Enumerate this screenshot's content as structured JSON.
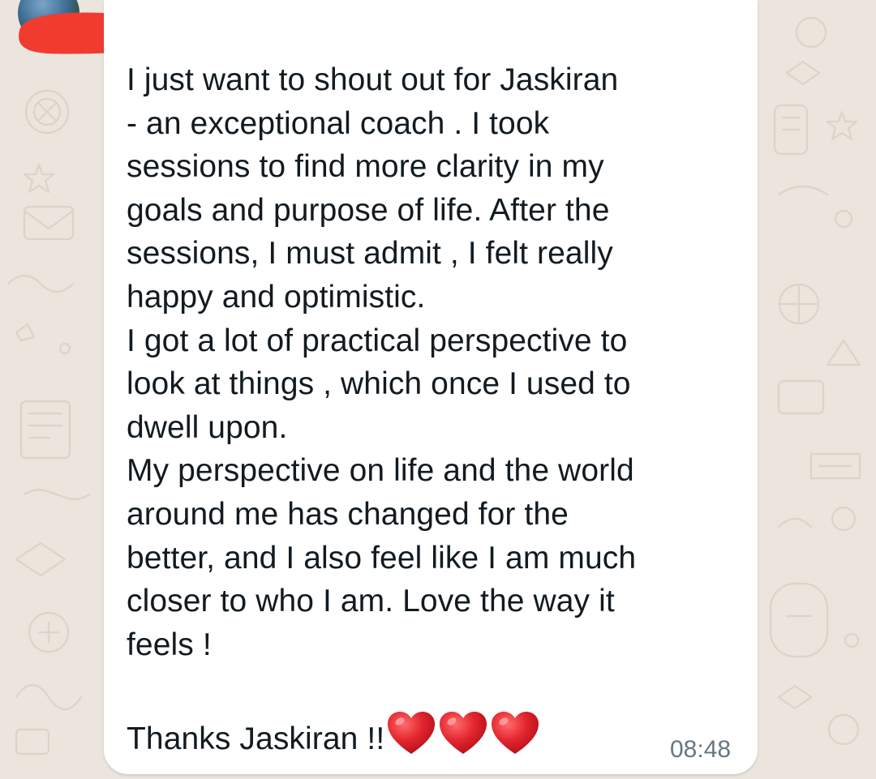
{
  "chat": {
    "message_lines": [
      "I just want to shout out for Jaskiran",
      "- an exceptional coach . I took",
      "sessions to find more clarity in my",
      "goals and purpose of life. After the",
      "sessions, I must admit , I felt really",
      "happy and optimistic.",
      "I got a lot of practical perspective to",
      "look at things , which once I used to",
      "dwell upon.",
      "My perspective on life and the world",
      "around me has changed for the",
      "better, and I also feel like I am much",
      "closer to who I am. Love the way it",
      "feels !",
      "",
      "Thanks Jaskiran !!"
    ],
    "emoji": [
      "red-heart",
      "red-heart",
      "red-heart"
    ],
    "timestamp": "08:48"
  },
  "colors": {
    "wallpaper": "#ece5dd",
    "bubble": "#ffffff",
    "text": "#111b21",
    "timestamp": "#667781",
    "redaction": "#f23b2f",
    "heart": "#e3262f"
  }
}
